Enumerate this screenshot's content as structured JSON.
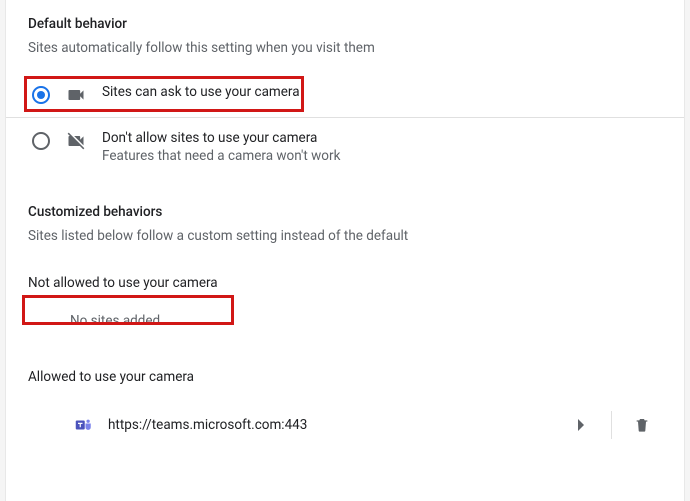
{
  "default_behavior": {
    "title": "Default behavior",
    "subtitle": "Sites automatically follow this setting when you visit them",
    "options": [
      {
        "label": "Sites can ask to use your camera",
        "sublabel": null,
        "selected": true,
        "icon": "camera-on-icon"
      },
      {
        "label": "Don't allow sites to use your camera",
        "sublabel": "Features that need a camera won't work",
        "selected": false,
        "icon": "camera-off-icon"
      }
    ]
  },
  "customized": {
    "title": "Customized behaviors",
    "subtitle": "Sites listed below follow a custom setting instead of the default"
  },
  "not_allowed": {
    "heading": "Not allowed to use your camera",
    "empty_text": "No sites added",
    "sites": []
  },
  "allowed": {
    "heading": "Allowed to use your camera",
    "sites": [
      {
        "url": "https://teams.microsoft.com:443",
        "favicon": "teams-icon"
      }
    ]
  }
}
